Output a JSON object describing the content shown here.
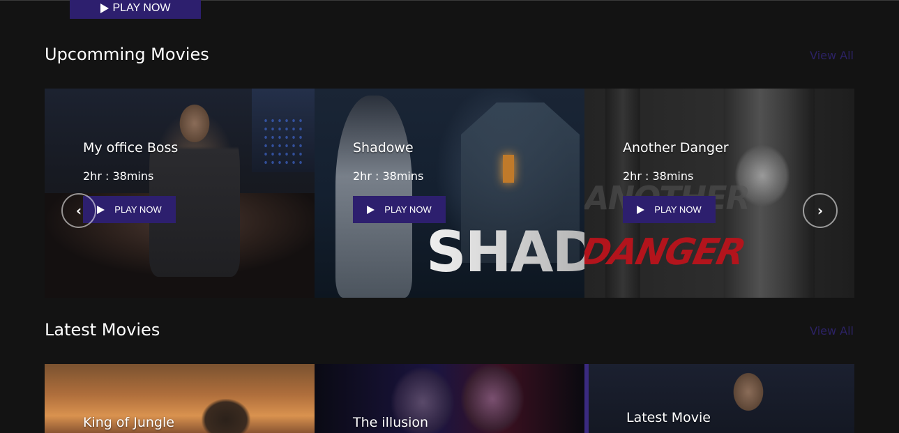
{
  "top": {
    "play_label": "PLAY NOW"
  },
  "upcoming": {
    "title": "Upcomming Movies",
    "view_all": "View All",
    "cards": [
      {
        "title": "My office Boss",
        "duration": "2hr : 38mins",
        "play_label": "PLAY NOW"
      },
      {
        "title": "Shadowe",
        "duration": "2hr : 38mins",
        "play_label": "PLAY NOW",
        "poster_text": "SHADOW"
      },
      {
        "title": "Another Danger",
        "duration": "2hr : 38mins",
        "play_label": "PLAY NOW",
        "poster_text": "DANGER",
        "poster_text_2": "ANOTHER"
      }
    ],
    "prev_icon": "chevron-left-icon",
    "next_icon": "chevron-right-icon"
  },
  "latest": {
    "title": "Latest Movies",
    "view_all": "View All",
    "cards": [
      {
        "title": "King of Jungle"
      },
      {
        "title": "The illusion"
      },
      {
        "title": "Latest Movie"
      }
    ]
  },
  "colors": {
    "accent": "#2d1f6e",
    "background": "#131313",
    "link": "#2c2265"
  }
}
